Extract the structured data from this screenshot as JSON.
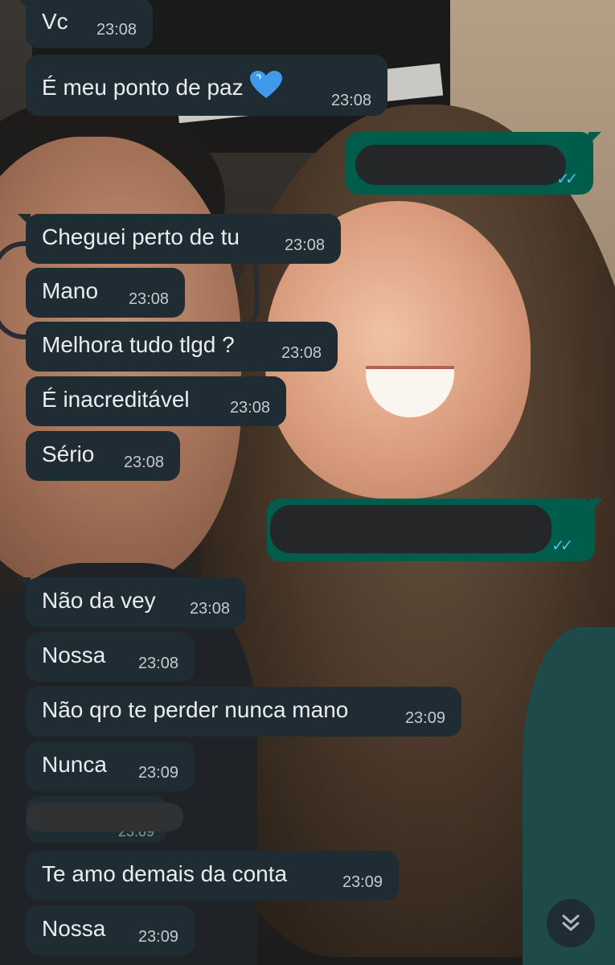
{
  "messages": [
    {
      "text": "Vc",
      "time": "23:08"
    },
    {
      "text": "É meu ponto de paz",
      "emoji": "blue-heart",
      "time": "23:08"
    },
    {
      "text": "Cheguei perto de tu",
      "time": "23:08"
    },
    {
      "text": "Mano",
      "time": "23:08"
    },
    {
      "text": "Melhora tudo tlgd ?",
      "time": "23:08"
    },
    {
      "text": "É inacreditável",
      "time": "23:08"
    },
    {
      "text": "Sério",
      "time": "23:08"
    },
    {
      "text": "Não da vey",
      "time": "23:08"
    },
    {
      "text": "Nossa",
      "time": "23:08"
    },
    {
      "text": "Não qro te perder nunca mano",
      "time": "23:09"
    },
    {
      "text": "Nunca",
      "time": "23:09"
    },
    {
      "text": "Te amo demais da conta",
      "time": "23:09"
    },
    {
      "text": "Nossa",
      "time": "23:09"
    }
  ],
  "redacted_time_fragment": "23:09",
  "outgoing_ticks": "✓✓",
  "colors": {
    "incoming_bubble": "#1f2c33",
    "outgoing_bubble": "#005c4b",
    "read_ticks": "#53bdeb",
    "text": "#e9edef"
  },
  "icons": {
    "scroll_down": "double-chevron-down-icon",
    "heart": "blue-heart-icon"
  }
}
